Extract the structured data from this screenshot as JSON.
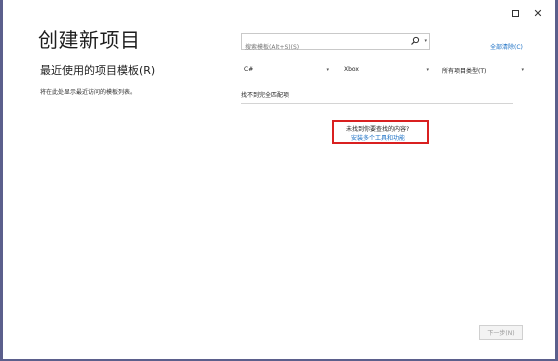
{
  "window": {
    "maximize_icon": "maximize-icon",
    "close_glyph": "✕"
  },
  "page": {
    "title": "创建新项目",
    "recent_heading": "最近使用的项目模板(R)",
    "recent_description": "将在此处显示最近访问的模板列表。"
  },
  "search": {
    "placeholder": "搜索模板(Alt+S)(S)",
    "value": "",
    "icon": "search-icon",
    "dropdown_glyph": "▾"
  },
  "clear_all_label": "全部清除(C)",
  "filters": [
    {
      "name": "language",
      "value": "C#"
    },
    {
      "name": "platform",
      "value": "Xbox"
    },
    {
      "name": "project-type",
      "value": "所有项目类型(T)"
    }
  ],
  "results": {
    "no_exact_match": "找不到完全匹配项",
    "not_found_question": "未找到你要查找的内容?",
    "install_link": "安装多个工具和功能"
  },
  "next_button_label": "下一步(N)",
  "colors": {
    "frame": "#5b5f8c",
    "link": "#1a6fc4",
    "highlight": "#d92020"
  }
}
